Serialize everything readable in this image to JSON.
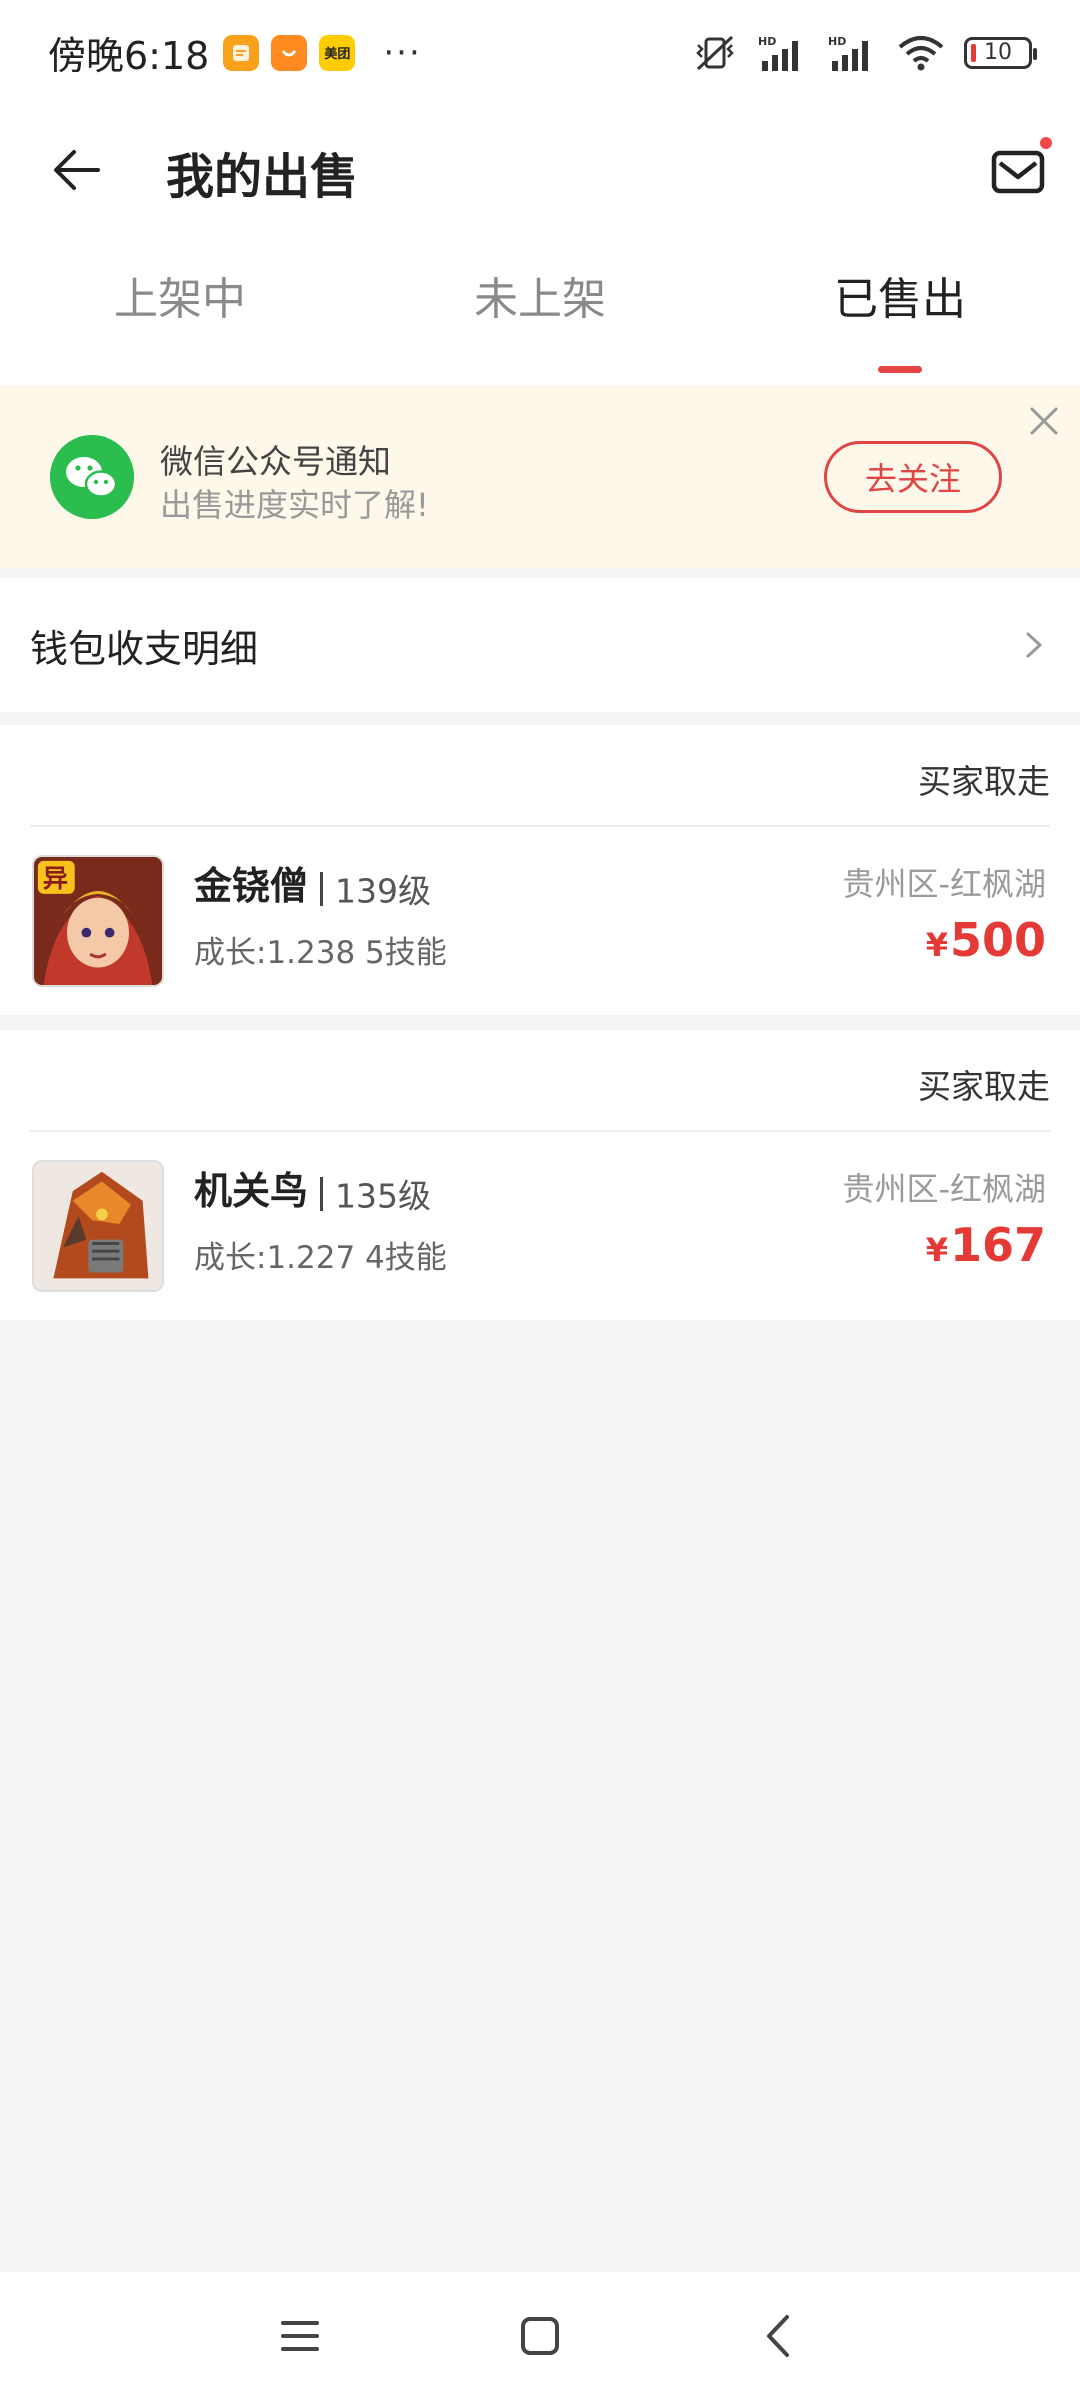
{
  "status_bar": {
    "time": "傍晚6:18",
    "apps": [
      {
        "name": "note-app-icon",
        "color": "#f9a11b",
        "label": ""
      },
      {
        "name": "taobao-app-icon",
        "color": "#ff8a1f",
        "label": ""
      },
      {
        "name": "meituan-app-icon",
        "color": "#ffcc00",
        "label": "美团"
      }
    ],
    "more": "···",
    "battery": "10"
  },
  "header": {
    "title": "我的出售"
  },
  "tabs": [
    {
      "label": "上架中",
      "active": false
    },
    {
      "label": "未上架",
      "active": false
    },
    {
      "label": "已售出",
      "active": true
    }
  ],
  "notice": {
    "title": "微信公众号通知",
    "subtitle": "出售进度实时了解!",
    "button": "去关注"
  },
  "wallet": {
    "label": "钱包收支明细"
  },
  "orders": [
    {
      "status": "买家取走",
      "name": "金铙僧",
      "level": "139级",
      "stats": "成长:1.238 5技能",
      "server": "贵州区-红枫湖",
      "currency": "¥",
      "price": "500"
    },
    {
      "status": "买家取走",
      "name": "机关鸟",
      "level": "135级",
      "stats": "成长:1.227 4技能",
      "server": "贵州区-红枫湖",
      "currency": "¥",
      "price": "167"
    }
  ],
  "colors": {
    "accent": "#e53935",
    "notice_bg": "#fdf8ea",
    "wechat_green": "#2bbd4e"
  }
}
